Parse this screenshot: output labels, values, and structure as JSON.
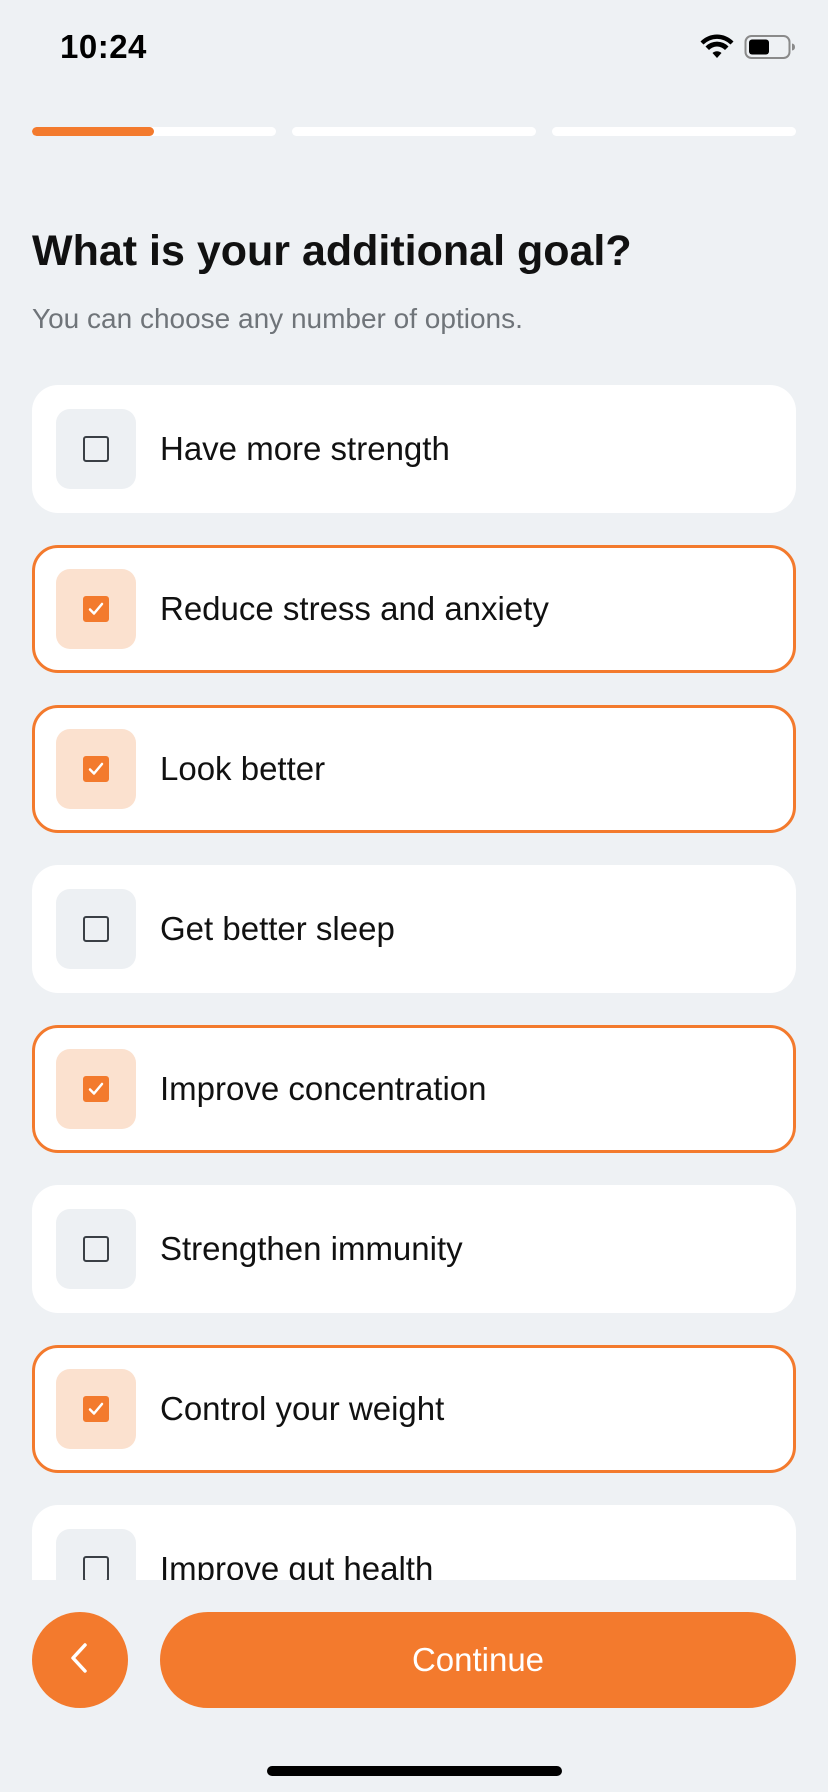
{
  "status_bar": {
    "time": "10:24",
    "icons": [
      "wifi-icon",
      "battery-icon"
    ]
  },
  "progress": {
    "segments": 3,
    "current_step_fraction": 0.5,
    "current_segment": 1
  },
  "question": {
    "title": "What is your additional goal?",
    "subtitle": "You can choose any number of options."
  },
  "options": [
    {
      "label": "Have more strength",
      "selected": false
    },
    {
      "label": "Reduce stress and anxiety",
      "selected": true
    },
    {
      "label": "Look better",
      "selected": true
    },
    {
      "label": "Get better sleep",
      "selected": false
    },
    {
      "label": "Improve concentration",
      "selected": true
    },
    {
      "label": "Strengthen immunity",
      "selected": false
    },
    {
      "label": "Control your weight",
      "selected": true
    },
    {
      "label": "Improve gut health",
      "selected": false
    }
  ],
  "footer": {
    "back_icon": "chevron-left-icon",
    "continue_label": "Continue"
  },
  "colors": {
    "accent": "#F37A2D",
    "accent_light": "#FBE1CF",
    "background": "#EEF1F4",
    "card": "#FFFFFF"
  }
}
